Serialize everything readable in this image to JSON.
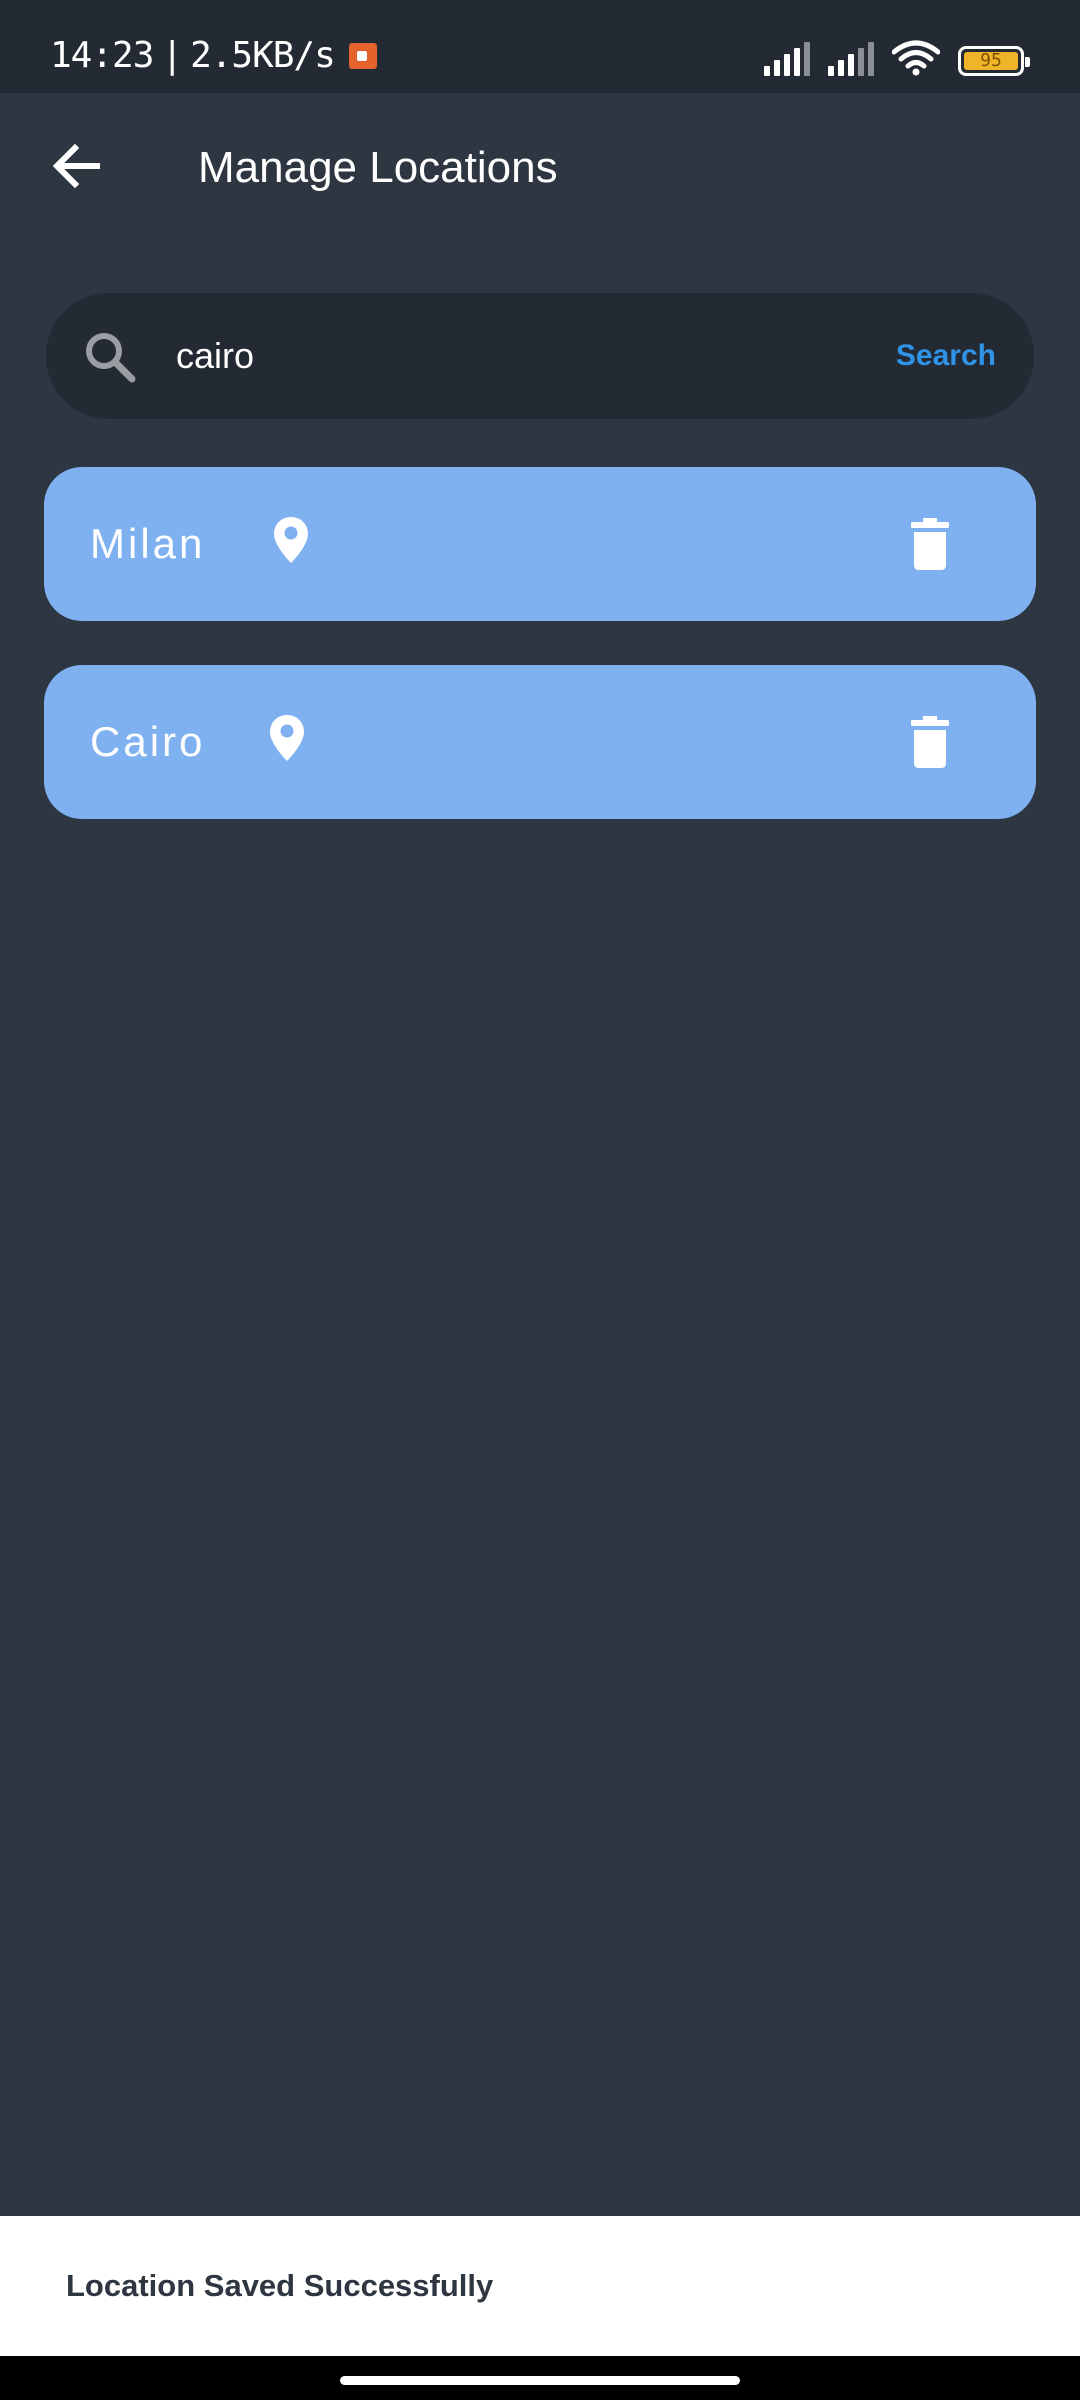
{
  "status_bar": {
    "time": "14:23",
    "separator": "|",
    "network_speed": "2.5KB/s",
    "battery_level": "95",
    "icons": [
      "screen-record-icon",
      "signal-icon",
      "signal-icon",
      "wifi-icon",
      "battery-icon"
    ],
    "colors": {
      "record": "#e4622b",
      "battery": "#f0b429"
    }
  },
  "app_bar": {
    "title": "Manage Locations",
    "back_icon": "arrow-left-icon"
  },
  "search": {
    "value": "cairo",
    "placeholder": "",
    "button_label": "Search",
    "icon": "search-icon",
    "accent_color": "#2f93e8"
  },
  "locations": [
    {
      "name": "Milan",
      "pin_icon": "location-pin-icon",
      "delete_icon": "trash-icon"
    },
    {
      "name": "Cairo",
      "pin_icon": "location-pin-icon",
      "delete_icon": "trash-icon"
    }
  ],
  "snackbar": {
    "message": "Location Saved Successfully"
  },
  "theme": {
    "background": "#2e3641",
    "card": "#7fb1f1",
    "search_field": "#232a33"
  }
}
